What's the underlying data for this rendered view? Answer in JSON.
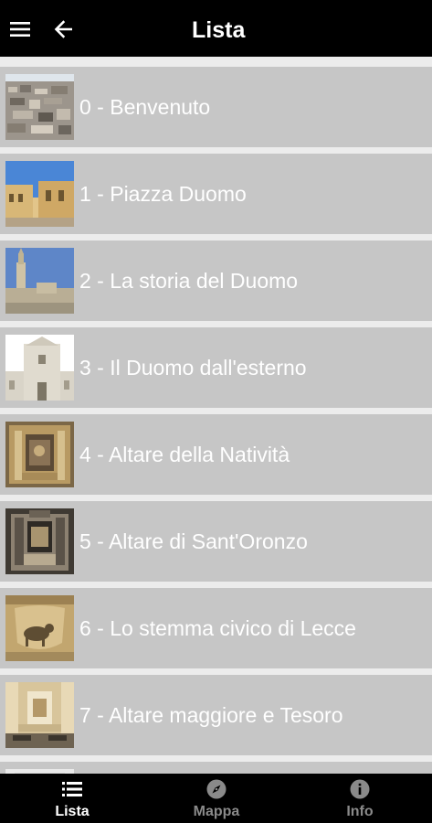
{
  "header": {
    "title": "Lista",
    "menu_icon": "hamburger-menu-icon",
    "back_icon": "arrow-back-icon"
  },
  "list": {
    "items": [
      {
        "label": "0 - Benvenuto",
        "thumb": "aerial-city-view"
      },
      {
        "label": "1 - Piazza Duomo",
        "thumb": "piazza-duomo"
      },
      {
        "label": "2 - La storia del Duomo",
        "thumb": "bell-tower"
      },
      {
        "label": "3 - Il Duomo dall'esterno",
        "thumb": "cathedral-facade"
      },
      {
        "label": "4 - Altare della Natività",
        "thumb": "baroque-altar-nativity"
      },
      {
        "label": "5 - Altare di Sant'Oronzo",
        "thumb": "baroque-altar-oronzo"
      },
      {
        "label": "6 - Lo stemma civico di Lecce",
        "thumb": "civic-coat-of-arms"
      },
      {
        "label": "7 - Altare maggiore e Tesoro",
        "thumb": "main-altar-nave"
      },
      {
        "label": "",
        "thumb": "partial-next-item"
      }
    ]
  },
  "bottom_nav": {
    "items": [
      {
        "label": "Lista",
        "icon": "list-icon",
        "active": true
      },
      {
        "label": "Mappa",
        "icon": "compass-icon",
        "active": false
      },
      {
        "label": "Info",
        "icon": "info-icon",
        "active": false
      }
    ]
  },
  "colors": {
    "app_bar": "#000000",
    "list_background": "#ececec",
    "item_background": "#c6c6c6",
    "item_text": "#ffffff",
    "nav_active": "#ffffff",
    "nav_inactive": "#8a8a8a"
  }
}
